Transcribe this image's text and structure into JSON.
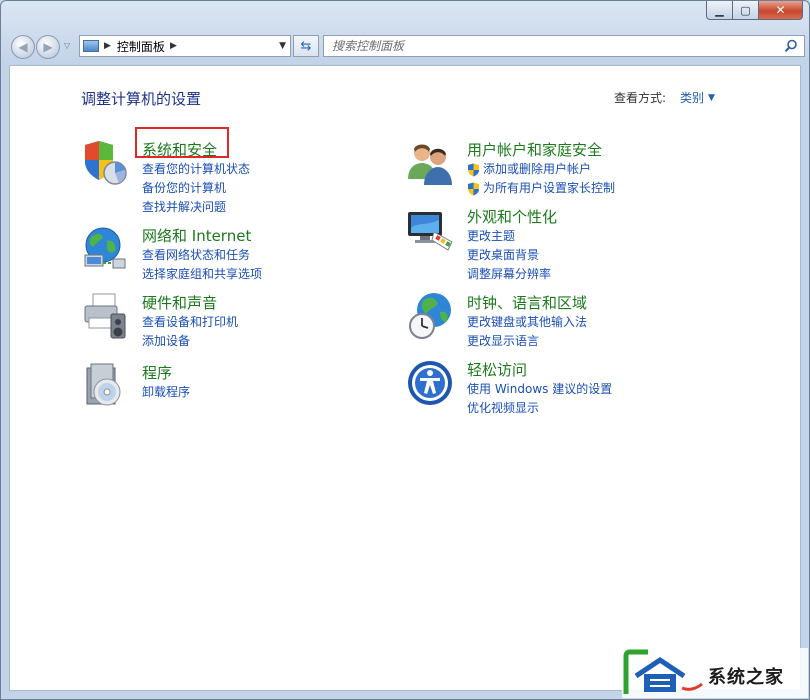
{
  "window": {
    "minimize_glyph": "▁",
    "maximize_glyph": "▢",
    "close_glyph": "✕"
  },
  "nav": {
    "breadcrumb": "控制面板",
    "search_placeholder": "搜索控制面板"
  },
  "content": {
    "page_title": "调整计算机的设置",
    "view_by_label": "查看方式:",
    "view_by_value": "类别"
  },
  "categories": [
    {
      "title": "系统和安全",
      "icon": "shield-computer-icon",
      "links": [
        "查看您的计算机状态",
        "备份您的计算机",
        "查找并解决问题"
      ]
    },
    {
      "title": "网络和 Internet",
      "icon": "network-globe-icon",
      "links": [
        "查看网络状态和任务",
        "选择家庭组和共享选项"
      ]
    },
    {
      "title": "硬件和声音",
      "icon": "printer-speaker-icon",
      "links": [
        "查看设备和打印机",
        "添加设备"
      ]
    },
    {
      "title": "程序",
      "icon": "programs-disc-icon",
      "links": [
        "卸载程序"
      ]
    },
    {
      "title": "用户帐户和家庭安全",
      "icon": "users-icon",
      "links": [
        "添加或删除用户帐户",
        "为所有用户设置家长控制"
      ],
      "shield_links": true
    },
    {
      "title": "外观和个性化",
      "icon": "monitor-palette-icon",
      "links": [
        "更改主题",
        "更改桌面背景",
        "调整屏幕分辨率"
      ]
    },
    {
      "title": "时钟、语言和区域",
      "icon": "clock-globe-icon",
      "links": [
        "更改键盘或其他输入法",
        "更改显示语言"
      ]
    },
    {
      "title": "轻松访问",
      "icon": "ease-of-access-icon",
      "links": [
        "使用 Windows 建议的设置",
        "优化视频显示"
      ]
    }
  ],
  "watermark": {
    "text": "系统之家"
  },
  "colors": {
    "category_title": "#1c7a1c",
    "link": "#1a4fb5",
    "page_title": "#1e3287",
    "highlight_box": "#e0282a"
  }
}
